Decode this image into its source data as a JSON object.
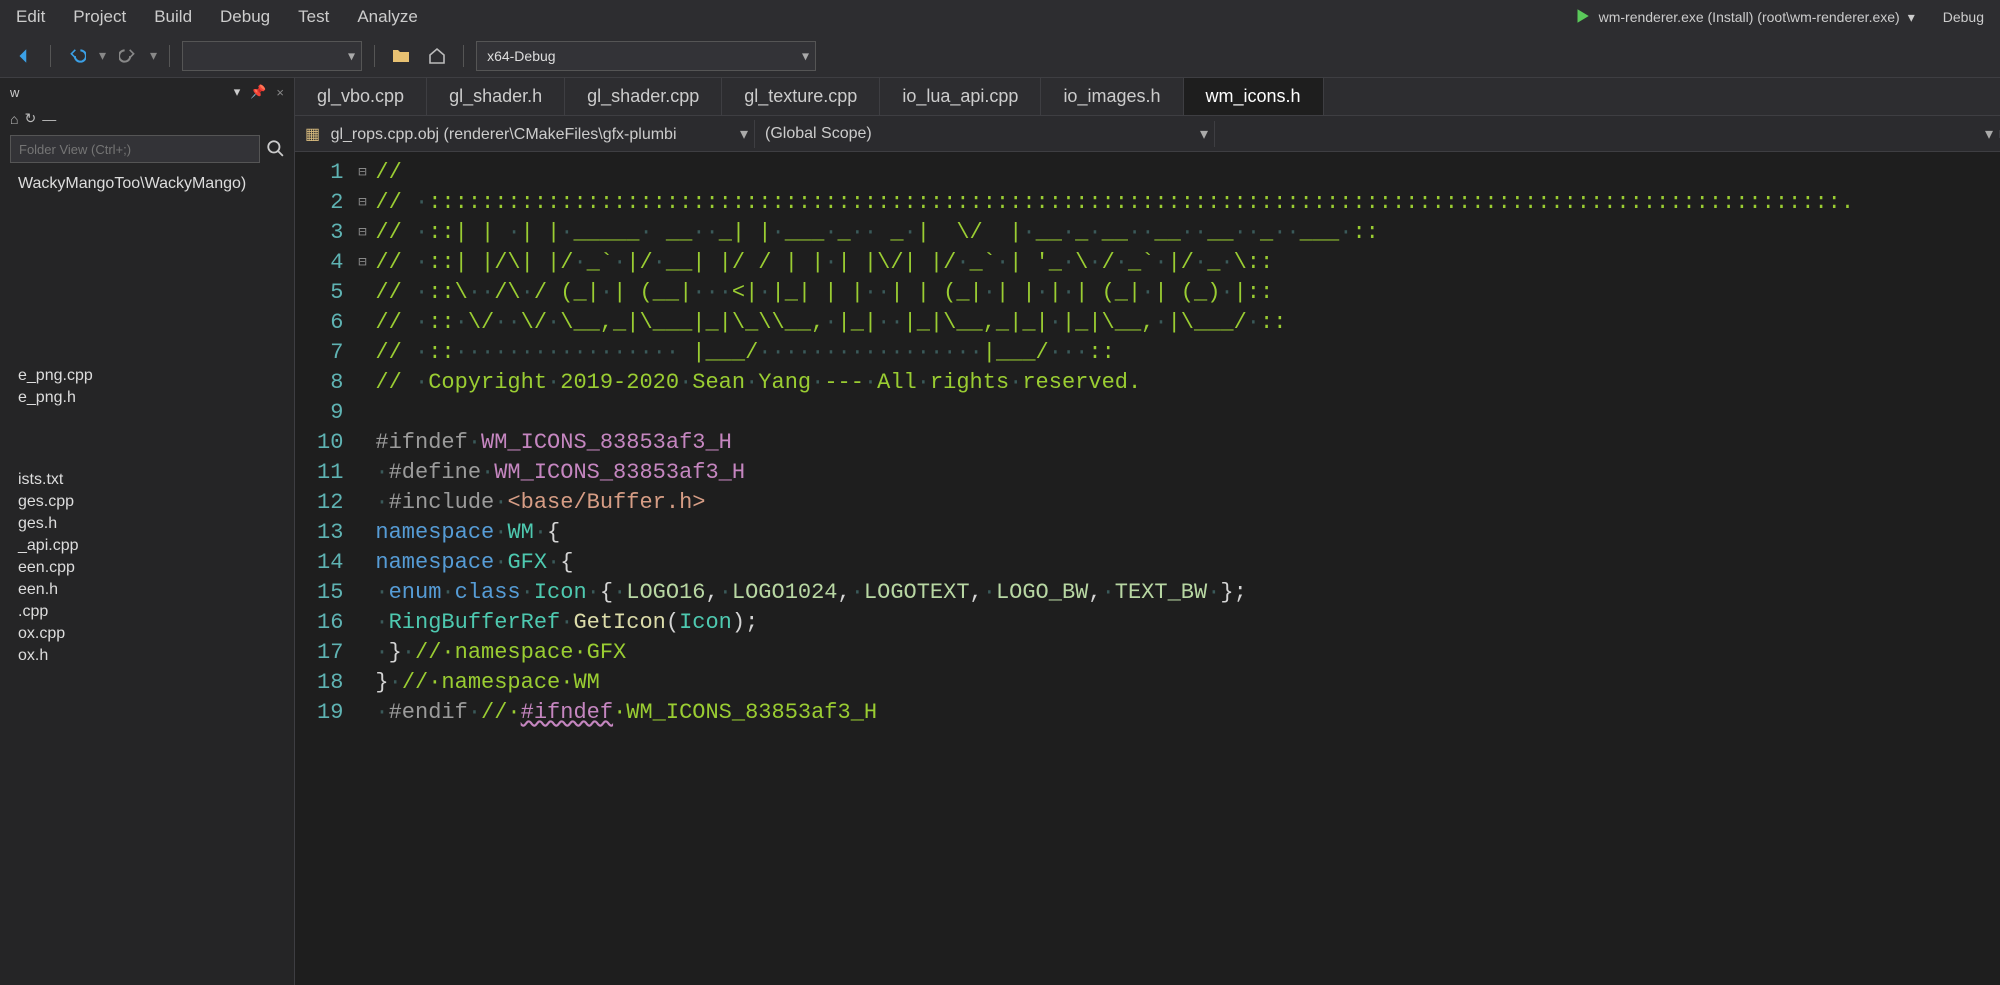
{
  "menu": {
    "items": [
      "Edit",
      "Project",
      "Build",
      "Debug",
      "Test",
      "Analyze"
    ]
  },
  "toolbar": {
    "config": "x64-Debug",
    "run_target": "wm-renderer.exe (Install) (root\\wm-renderer.exe)",
    "run_config": "Debug"
  },
  "side": {
    "title_suffix": "w",
    "pin_glyph": "📌",
    "close_glyph": "×",
    "search_placeholder": "Folder View (Ctrl+;)",
    "root": "WackyMangoToo\\WackyMango)",
    "files": [
      "e_png.cpp",
      "e_png.h",
      "",
      "ists.txt",
      "ges.cpp",
      "ges.h",
      "_api.cpp",
      "een.cpp",
      "een.h",
      ".cpp",
      "ox.cpp",
      "ox.h"
    ]
  },
  "tabs": [
    {
      "label": "gl_vbo.cpp",
      "active": false
    },
    {
      "label": "gl_shader.h",
      "active": false
    },
    {
      "label": "gl_shader.cpp",
      "active": false
    },
    {
      "label": "gl_texture.cpp",
      "active": false
    },
    {
      "label": "io_lua_api.cpp",
      "active": false
    },
    {
      "label": "io_images.h",
      "active": false
    },
    {
      "label": "wm_icons.h",
      "active": true
    }
  ],
  "nav": {
    "left": "gl_rops.cpp.obj (renderer\\CMakeFiles\\gfx-plumbi",
    "right": "(Global Scope)"
  },
  "code": {
    "line_count": 19,
    "lines": [
      "//",
      "// ·:::::::::::::::::::::::::::::::::::::::::::::::::::::::::::::::::::::::::::::::::::::::::::::::::::::::::::.",
      "// ·::| | ·| |·_____· __··_| |·___·_·· _·|  \\/  |·__·_·__··__··__··_··___·::",
      "// ·::| |/\\| |/·_`·|/·__| |/ / | |·| |\\/| |/·_`·| '_·\\·/·_`·|/·_·\\::",
      "// ·::\\··/\\·/ (_|·| (__|···<|·|_| | |··| | (_|·| |·|·| (_|·| (_)·|::",
      "// ·::·\\/··\\/·\\__,_|\\___|_|\\_\\\\__,·|_|··|_|\\__,_|_|·|_|\\__,·|\\___/·::",
      "// ·::················· |___/·················|___/···::",
      "// ·Copyright·2019-2020·Sean·Yang·---·All·rights·reserved.",
      "",
      "#ifndef·WM_ICONS_83853af3_H",
      "·#define·WM_ICONS_83853af3_H",
      "·#include·<base/Buffer.h>",
      "namespace·WM·{",
      "namespace·GFX·{",
      "·enum·class·Icon·{·LOGO16,·LOGO1024,·LOGOTEXT,·LOGO_BW,·TEXT_BW·};",
      "·RingBufferRef·GetIcon(Icon);",
      "·}·//·namespace·GFX",
      "}·//·namespace·WM",
      "·#endif·//·#ifndef·WM_ICONS_83853af3_H"
    ],
    "fold_markers": {
      "1": "⊟",
      "10": "⊟",
      "13": "⊟",
      "14": "⊟"
    }
  }
}
